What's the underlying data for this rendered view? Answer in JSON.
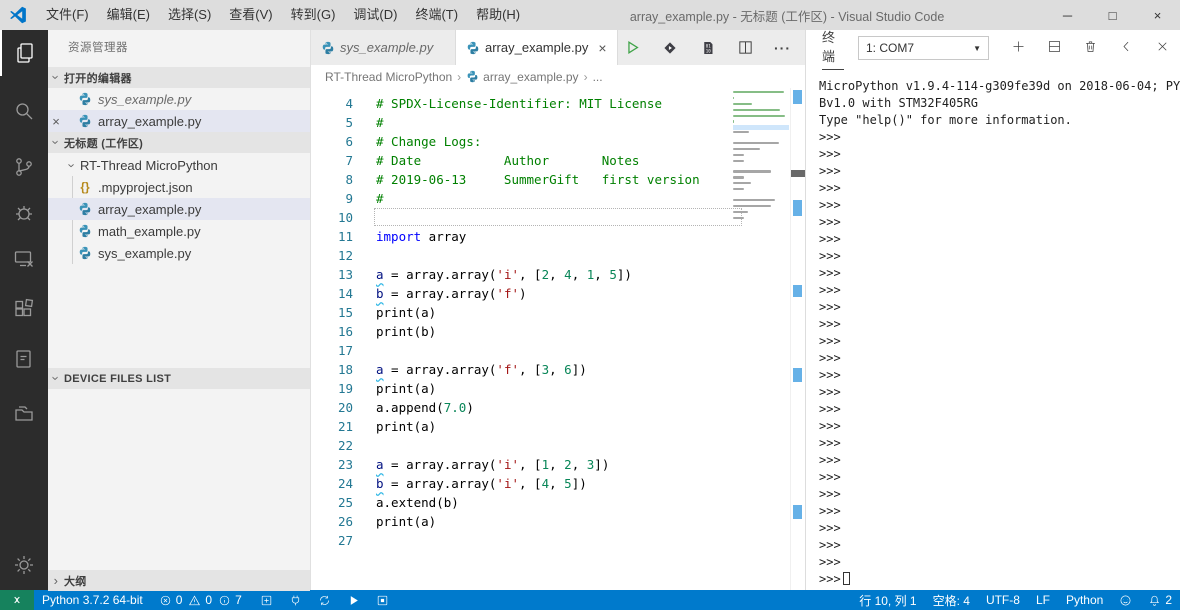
{
  "window": {
    "title": "array_example.py - 无标题 (工作区) - Visual Studio Code",
    "menus": [
      "文件(F)",
      "编辑(E)",
      "选择(S)",
      "查看(V)",
      "转到(G)",
      "调试(D)",
      "终端(T)",
      "帮助(H)"
    ],
    "controls": {
      "minimize": "─",
      "maximize": "□",
      "close": "×"
    }
  },
  "colors": {
    "accent": "#007acc",
    "remote": "#16825d",
    "title_bar": "#dddddd",
    "activity_bar": "#2c2c2c",
    "selection": "#e4e6f1",
    "comment": "#008000",
    "keyword": "#0000ff",
    "string": "#a31515",
    "number": "#098658",
    "line_number": "#237893",
    "info_squiggle": "#33b8e5",
    "run_green": "#3fa348",
    "python_icon": "#3a93b8"
  },
  "icons": {
    "dropdown_caret": "▼",
    "more": "···",
    "close": "×",
    "chevron": "›"
  },
  "activity_bar": {
    "items": [
      "explorer",
      "search",
      "source-control",
      "debug",
      "remote-device",
      "extensions",
      "notes",
      "folders"
    ],
    "bottom": [
      "settings-gear"
    ],
    "active": "explorer"
  },
  "sidebar": {
    "title": "资源管理器",
    "open_editors": {
      "label": "打开的编辑器",
      "items": [
        {
          "name": "sys_example.py",
          "italic": true,
          "selected": false,
          "close": false
        },
        {
          "name": "array_example.py",
          "italic": false,
          "selected": true,
          "close": true
        }
      ]
    },
    "workspace": {
      "label": "无标题 (工作区)",
      "folder": "RT-Thread MicroPython",
      "files": [
        {
          "name": ".mpyproject.json",
          "type": "json",
          "selected": false
        },
        {
          "name": "array_example.py",
          "type": "python",
          "selected": true
        },
        {
          "name": "math_example.py",
          "type": "python",
          "selected": false
        },
        {
          "name": "sys_example.py",
          "type": "python",
          "selected": false
        }
      ]
    },
    "device_files": {
      "label": "DEVICE FILES LIST"
    },
    "outline": {
      "label": "大纲"
    }
  },
  "editor": {
    "tabs": [
      {
        "name": "sys_example.py",
        "active": false,
        "italic": true,
        "close": false
      },
      {
        "name": "array_example.py",
        "active": true,
        "italic": false,
        "close": true
      }
    ],
    "breadcrumb": [
      "RT-Thread MicroPython",
      "array_example.py",
      "..."
    ],
    "lines": [
      {
        "n": 4,
        "segs": [
          [
            "# SPDX-License-Identifier: MIT License",
            "cm"
          ]
        ]
      },
      {
        "n": 5,
        "segs": [
          [
            "#",
            "cm"
          ]
        ]
      },
      {
        "n": 6,
        "segs": [
          [
            "# Change Logs:",
            "cm"
          ]
        ]
      },
      {
        "n": 7,
        "segs": [
          [
            "# Date           Author       Notes",
            "cm"
          ]
        ]
      },
      {
        "n": 8,
        "segs": [
          [
            "# 2019-06-13     SummerGift   first version",
            "cm"
          ]
        ]
      },
      {
        "n": 9,
        "segs": [
          [
            "#",
            "cm"
          ]
        ]
      },
      {
        "n": 10,
        "cur": true,
        "segs": []
      },
      {
        "n": 11,
        "segs": [
          [
            "import",
            "kw"
          ],
          [
            " array",
            "pl"
          ]
        ]
      },
      {
        "n": 12,
        "segs": []
      },
      {
        "n": 13,
        "segs": [
          [
            "a",
            "var"
          ],
          [
            " = array.array(",
            "pl"
          ],
          [
            "'i'",
            "str"
          ],
          [
            ", [",
            "pl"
          ],
          [
            "2",
            "num"
          ],
          [
            ", ",
            "pl"
          ],
          [
            "4",
            "num"
          ],
          [
            ", ",
            "pl"
          ],
          [
            "1",
            "num"
          ],
          [
            ", ",
            "pl"
          ],
          [
            "5",
            "num"
          ],
          [
            "])",
            "pl"
          ]
        ]
      },
      {
        "n": 14,
        "segs": [
          [
            "b",
            "var"
          ],
          [
            " = array.array(",
            "pl"
          ],
          [
            "'f'",
            "str"
          ],
          [
            ")",
            "pl"
          ]
        ]
      },
      {
        "n": 15,
        "segs": [
          [
            "print(a)",
            "pl"
          ]
        ]
      },
      {
        "n": 16,
        "segs": [
          [
            "print(b)",
            "pl"
          ]
        ]
      },
      {
        "n": 17,
        "segs": []
      },
      {
        "n": 18,
        "segs": [
          [
            "a",
            "var"
          ],
          [
            " = array.array(",
            "pl"
          ],
          [
            "'f'",
            "str"
          ],
          [
            ", [",
            "pl"
          ],
          [
            "3",
            "num"
          ],
          [
            ", ",
            "pl"
          ],
          [
            "6",
            "num"
          ],
          [
            "])",
            "pl"
          ]
        ]
      },
      {
        "n": 19,
        "segs": [
          [
            "print(a)",
            "pl"
          ]
        ]
      },
      {
        "n": 20,
        "segs": [
          [
            "a.append(",
            "pl"
          ],
          [
            "7.0",
            "num"
          ],
          [
            ")",
            "pl"
          ]
        ]
      },
      {
        "n": 21,
        "segs": [
          [
            "print(a)",
            "pl"
          ]
        ]
      },
      {
        "n": 22,
        "segs": []
      },
      {
        "n": 23,
        "segs": [
          [
            "a",
            "var"
          ],
          [
            " = array.array(",
            "pl"
          ],
          [
            "'i'",
            "str"
          ],
          [
            ", [",
            "pl"
          ],
          [
            "1",
            "num"
          ],
          [
            ", ",
            "pl"
          ],
          [
            "2",
            "num"
          ],
          [
            ", ",
            "pl"
          ],
          [
            "3",
            "num"
          ],
          [
            "])",
            "pl"
          ]
        ]
      },
      {
        "n": 24,
        "segs": [
          [
            "b",
            "var"
          ],
          [
            " = array.array(",
            "pl"
          ],
          [
            "'i'",
            "str"
          ],
          [
            ", [",
            "pl"
          ],
          [
            "4",
            "num"
          ],
          [
            ", ",
            "pl"
          ],
          [
            "5",
            "num"
          ],
          [
            "])",
            "pl"
          ]
        ]
      },
      {
        "n": 25,
        "segs": [
          [
            "a.extend(b)",
            "pl"
          ]
        ]
      },
      {
        "n": 26,
        "segs": [
          [
            "print(a)",
            "pl"
          ]
        ]
      },
      {
        "n": 27,
        "segs": []
      }
    ]
  },
  "terminal": {
    "tab": "终端",
    "dropdown": "1: COM7",
    "intro": [
      "MicroPython v1.9.4-114-g309fe39d on 2018-06-04; PY",
      "Bv1.0 with STM32F405RG",
      "Type \"help()\" for more information."
    ],
    "prompt": ">>>",
    "prompt_count": 26
  },
  "status_bar": {
    "python_version": "Python 3.7.2 64-bit",
    "problems": {
      "errors": "0",
      "warnings": "0",
      "infos": "7"
    },
    "line_col": "行 10, 列 1",
    "spaces": "空格: 4",
    "encoding": "UTF-8",
    "eol": "LF",
    "language": "Python",
    "bell_count": "2"
  }
}
